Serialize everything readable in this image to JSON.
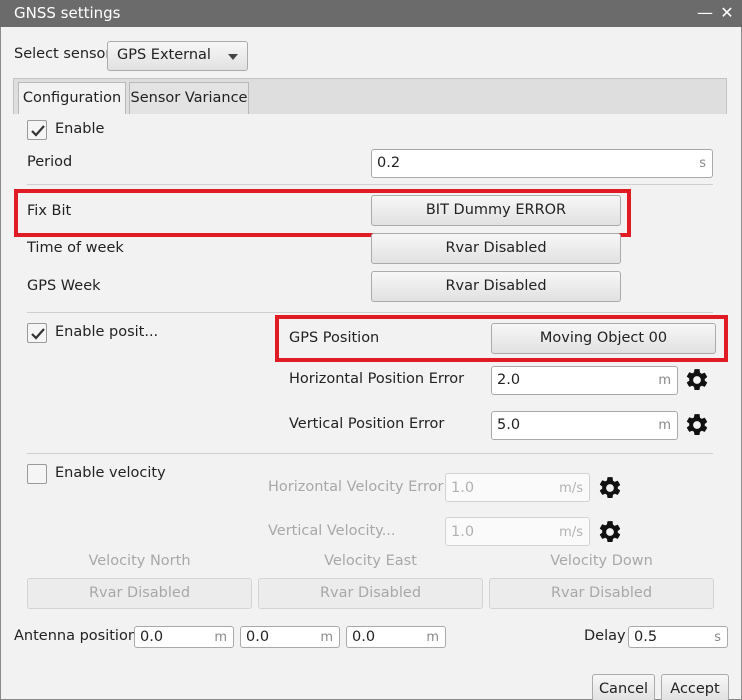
{
  "window": {
    "title": "GNSS settings",
    "minimize_glyph": "—",
    "close_glyph": "✕"
  },
  "select_sensor": {
    "label": "Select sensor",
    "value": "GPS External"
  },
  "tabs": [
    {
      "label": "Configuration",
      "active": true
    },
    {
      "label": "Sensor Variance",
      "active": false
    }
  ],
  "general": {
    "enable_label": "Enable",
    "enable_checked": true,
    "period_label": "Period",
    "period_value": "0.2",
    "period_unit": "s",
    "fix_bit_label": "Fix Bit",
    "fix_bit_value": "BIT Dummy ERROR",
    "time_of_week_label": "Time of week",
    "time_of_week_value": "Rvar Disabled",
    "gps_week_label": "GPS Week",
    "gps_week_value": "Rvar Disabled"
  },
  "position": {
    "enable_label": "Enable posit...",
    "enable_checked": true,
    "gps_position_label": "GPS Position",
    "gps_position_value": "Moving Object 00",
    "h_error_label": "Horizontal Position Error",
    "h_error_value": "2.0",
    "h_error_unit": "m",
    "v_error_label": "Vertical Position Error",
    "v_error_value": "5.0",
    "v_error_unit": "m"
  },
  "velocity": {
    "enable_label": "Enable velocity",
    "enable_checked": false,
    "h_error_label": "Horizontal Velocity Error",
    "h_error_value": "1.0",
    "h_error_unit": "m/s",
    "v_error_label": "Vertical Velocity...",
    "v_error_value": "1.0",
    "v_error_unit": "m/s",
    "north_label": "Velocity North",
    "north_value": "Rvar Disabled",
    "east_label": "Velocity East",
    "east_value": "Rvar Disabled",
    "down_label": "Velocity Down",
    "down_value": "Rvar Disabled"
  },
  "antenna": {
    "label": "Antenna position",
    "x": "0.0",
    "y": "0.0",
    "z": "0.0",
    "unit": "m"
  },
  "delay": {
    "label": "Delay",
    "value": "0.5",
    "unit": "s"
  },
  "footer": {
    "cancel_label": "Cancel",
    "accept_label": "Accept"
  },
  "colors": {
    "highlight": "#e01b24",
    "titlebar": "#6b6b6b"
  },
  "icons": {
    "settings": "gear-icon",
    "dropdown": "chevron-down-icon",
    "check": "checkmark-icon"
  }
}
